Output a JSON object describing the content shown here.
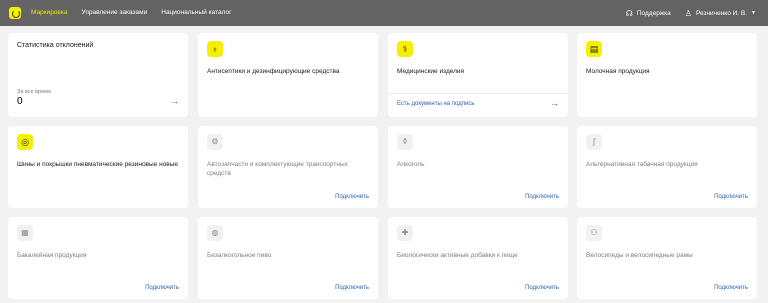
{
  "nav": {
    "items": [
      "Маркировка",
      "Управление заказами",
      "Национальный каталог"
    ],
    "support": "Поддержка",
    "user": "Резниченко И. В."
  },
  "stats": {
    "title": "Статистика отклонений",
    "period": "За все время",
    "value": "0"
  },
  "cards": {
    "antiseptics": {
      "title": "Антисептики и дезинфицирующие средства"
    },
    "medical": {
      "title": "Медицинские изделия",
      "docs_link": "Есть документы на подпись"
    },
    "dairy": {
      "title": "Молочная продукция"
    },
    "tires": {
      "title": "Шины и покрышки пневматические резиновые новые"
    },
    "autoparts": {
      "title": "Автозапчасти и комплектующие транспортных средств",
      "link": "Подключить"
    },
    "alcohol": {
      "title": "Алкоголь",
      "link": "Подключить"
    },
    "tobacco": {
      "title": "Альтернативная табачная продукция",
      "link": "Подключить"
    },
    "grocery": {
      "title": "Бакалейная продукция",
      "link": "Подключить"
    },
    "beer": {
      "title": "Безалкогольное пиво",
      "link": "Подключить"
    },
    "supplements": {
      "title": "Биологически активные добавки к пище",
      "link": "Подключить"
    },
    "bicycles": {
      "title": "Велосипеды и велосипедные рамы",
      "link": "Подключить"
    }
  },
  "colors": {
    "accent": "#f6f000",
    "topbar": "#636363",
    "link": "#2d63b0"
  },
  "icons": [
    "logo-icon",
    "headset-icon",
    "user-icon",
    "chevron-down-icon",
    "arrow-right-icon",
    "antiseptic-icon",
    "medical-device-icon",
    "dairy-icon",
    "tire-icon",
    "autoparts-icon",
    "alcohol-icon",
    "tobacco-icon",
    "grocery-icon",
    "beer-icon",
    "supplements-icon",
    "bicycle-icon"
  ]
}
